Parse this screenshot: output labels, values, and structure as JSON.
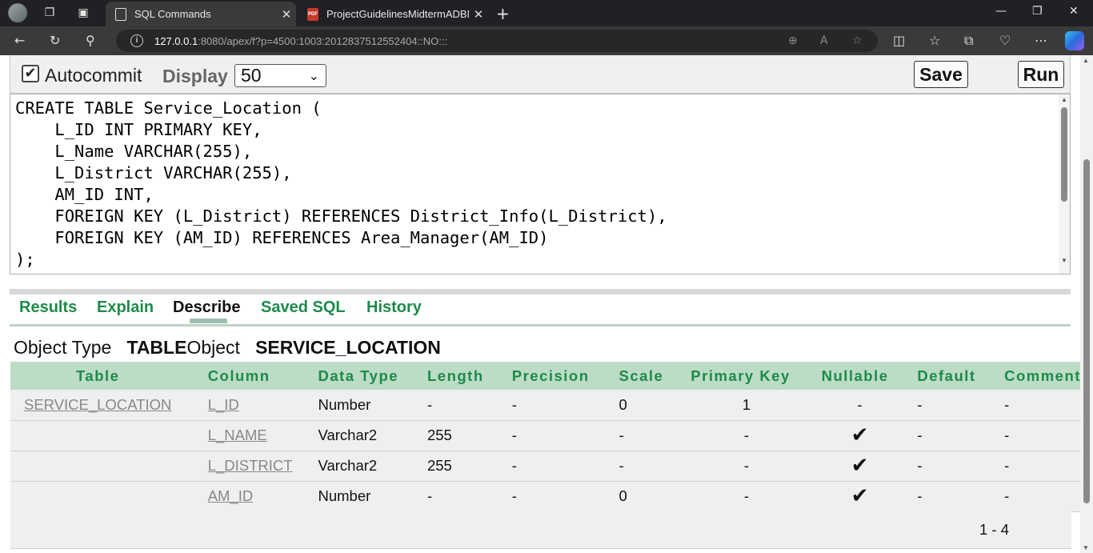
{
  "browser": {
    "tabs": [
      {
        "title": "SQL Commands",
        "close": "✕"
      },
      {
        "title": "ProjectGuidelinesMidtermADBMS",
        "close": "✕"
      }
    ],
    "url_host": "127.0.0.1",
    "url_rest": ":8080/apex/f?p=4500:1003:2012837512552404::NO:::"
  },
  "toolbar": {
    "autocommit_label": "Autocommit",
    "display_label": "Display",
    "display_value": "50",
    "save_label": "Save",
    "run_label": "Run"
  },
  "editor": {
    "lines": [
      "CREATE TABLE Service_Location (",
      "    L_ID INT PRIMARY KEY,",
      "    L_Name VARCHAR(255),",
      "    L_District VARCHAR(255),",
      "    AM_ID INT,",
      "    FOREIGN KEY (L_District) REFERENCES District_Info(L_District),",
      "    FOREIGN KEY (AM_ID) REFERENCES Area_Manager(AM_ID)",
      ");"
    ]
  },
  "result_tabs": [
    "Results",
    "Explain",
    "Describe",
    "Saved SQL",
    "History"
  ],
  "active_tab": "Describe",
  "object_info": {
    "type_label": "Object Type",
    "type_value": "TABLE",
    "object_label": "Object",
    "object_value": "SERVICE_LOCATION"
  },
  "describe": {
    "columns": [
      "Table",
      "Column",
      "Data Type",
      "Length",
      "Precision",
      "Scale",
      "Primary Key",
      "Nullable",
      "Default",
      "Comment"
    ],
    "rows": [
      {
        "table": "SERVICE_LOCATION",
        "column": "L_ID",
        "data_type": "Number",
        "length": "-",
        "precision": "-",
        "scale": "0",
        "primary_key": "1",
        "nullable": "-",
        "default": "-",
        "comment": "-"
      },
      {
        "table": "",
        "column": "L_NAME",
        "data_type": "Varchar2",
        "length": "255",
        "precision": "-",
        "scale": "-",
        "primary_key": "-",
        "nullable": "✔",
        "default": "-",
        "comment": "-"
      },
      {
        "table": "",
        "column": "L_DISTRICT",
        "data_type": "Varchar2",
        "length": "255",
        "precision": "-",
        "scale": "-",
        "primary_key": "-",
        "nullable": "✔",
        "default": "-",
        "comment": "-"
      },
      {
        "table": "",
        "column": "AM_ID",
        "data_type": "Number",
        "length": "-",
        "precision": "-",
        "scale": "0",
        "primary_key": "-",
        "nullable": "✔",
        "default": "-",
        "comment": "-"
      }
    ],
    "pagination": "1 - 4"
  }
}
